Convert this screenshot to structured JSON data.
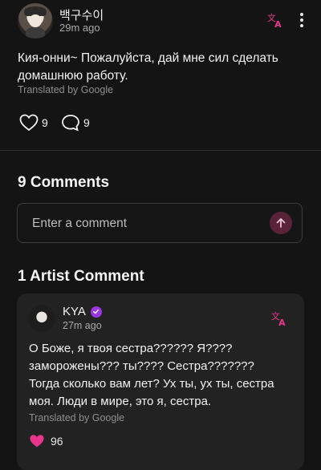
{
  "post": {
    "username": "백구수이",
    "time": "29m ago",
    "text": "Кия-онни~ Пожалуйста, дай мне сил сделать домашнюю работу.",
    "translated_note": "Translated by Google",
    "likes": "9",
    "comments": "9",
    "icons": {
      "translate": "translate-icon",
      "more": "more-vertical-icon",
      "like": "heart-outline-icon",
      "comment": "comment-bubble-icon"
    }
  },
  "comments_section": {
    "title": "9 Comments",
    "input_placeholder": "Enter a comment",
    "send_icon": "arrow-up-icon"
  },
  "artist_section": {
    "title": "1 Artist Comment",
    "artist_name": "KYA",
    "time": "27m ago",
    "text": "О Боже, я твоя сестра?????? Я???? заморожены??? ты???? Сестра??????? Тогда сколько вам лет? Ух ты, ух ты, сестра моя. Люди в мире, это я, сестра.",
    "translated_note": "Translated by Google",
    "likes": "96"
  },
  "colors": {
    "background": "#141414",
    "accent_pink": "#e8358c",
    "verified_purple": "#9b37e0",
    "card": "#222222"
  }
}
